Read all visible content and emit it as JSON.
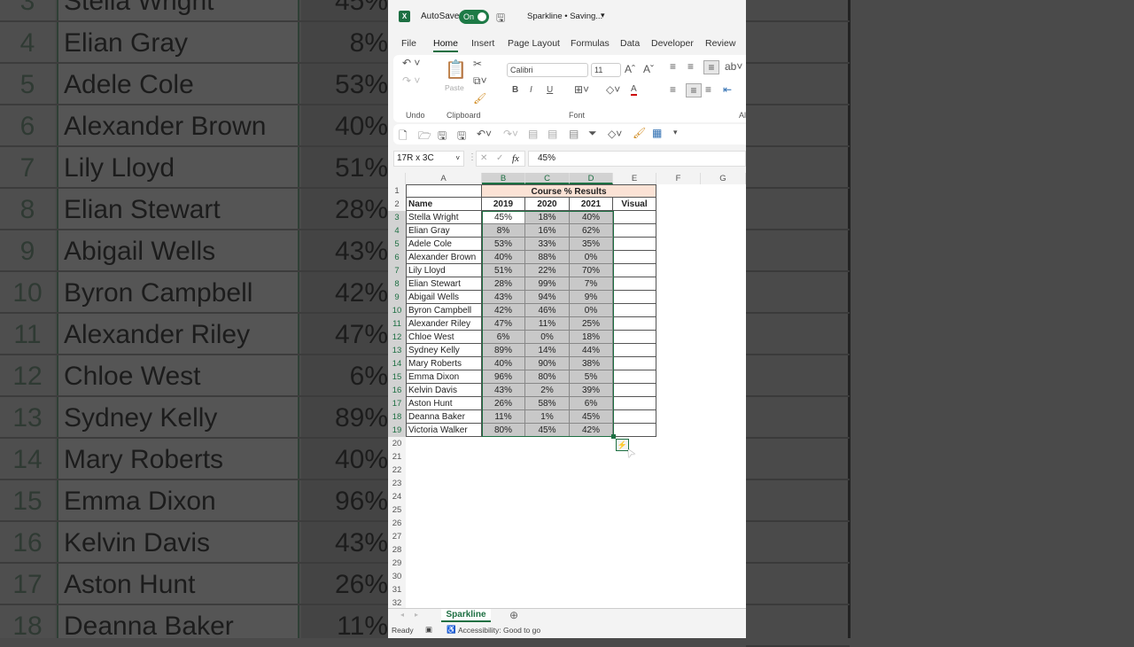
{
  "titlebar": {
    "app_icon": "excel-icon",
    "autosave_label": "AutoSave",
    "toggle_label": "On",
    "doc_title": "Sparkline • Saving...",
    "dropdown": "▾"
  },
  "menu": [
    "File",
    "Home",
    "Insert",
    "Page Layout",
    "Formulas",
    "Data",
    "Developer",
    "Review"
  ],
  "ribbon": {
    "undo_group": "Undo",
    "clipboard_group": "Clipboard",
    "paste_label": "Paste",
    "font_group": "Font",
    "font_name": "Calibri",
    "font_size": "11",
    "align_group": "Al",
    "bold": "B",
    "italic": "I",
    "underline": "U",
    "font_color": "A"
  },
  "formula_bar": {
    "name_box": "17R x 3C",
    "fx": "fx",
    "value": "45%"
  },
  "columns": [
    "A",
    "B",
    "C",
    "D",
    "E",
    "F",
    "G"
  ],
  "sheet": {
    "title": "Course % Results",
    "headers": [
      "Name",
      "2019",
      "2020",
      "2021",
      "Visual"
    ],
    "rows": [
      [
        "Stella Wright",
        "45%",
        "18%",
        "40%"
      ],
      [
        "Elian Gray",
        "8%",
        "16%",
        "62%"
      ],
      [
        "Adele Cole",
        "53%",
        "33%",
        "35%"
      ],
      [
        "Alexander Brown",
        "40%",
        "88%",
        "0%"
      ],
      [
        "Lily Lloyd",
        "51%",
        "22%",
        "70%"
      ],
      [
        "Elian Stewart",
        "28%",
        "99%",
        "7%"
      ],
      [
        "Abigail Wells",
        "43%",
        "94%",
        "9%"
      ],
      [
        "Byron Campbell",
        "42%",
        "46%",
        "0%"
      ],
      [
        "Alexander Riley",
        "47%",
        "11%",
        "25%"
      ],
      [
        "Chloe West",
        "6%",
        "0%",
        "18%"
      ],
      [
        "Sydney Kelly",
        "89%",
        "14%",
        "44%"
      ],
      [
        "Mary Roberts",
        "40%",
        "90%",
        "38%"
      ],
      [
        "Emma Dixon",
        "96%",
        "80%",
        "5%"
      ],
      [
        "Kelvin Davis",
        "43%",
        "2%",
        "39%"
      ],
      [
        "Aston Hunt",
        "26%",
        "58%",
        "6%"
      ],
      [
        "Deanna Baker",
        "11%",
        "1%",
        "45%"
      ],
      [
        "Victoria Walker",
        "80%",
        "45%",
        "42%"
      ]
    ],
    "visible_row_count": 32
  },
  "sheet_tab": "Sparkline",
  "status": {
    "ready": "Ready",
    "accessibility": "Accessibility: Good to go"
  },
  "colors": {
    "accent": "#1d6f42",
    "title_fill": "#fbe2d5",
    "selection": "#c8c8c8"
  }
}
